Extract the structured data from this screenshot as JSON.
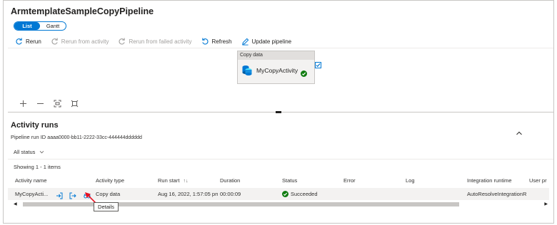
{
  "pipeline_title": "ArmtemplateSampleCopyPipeline",
  "view_toggle": {
    "list": "List",
    "gantt": "Gantt",
    "active": "list"
  },
  "toolbar": {
    "rerun": "Rerun",
    "rerun_from_activity": "Rerun from activity",
    "rerun_from_failed": "Rerun from failed activity",
    "refresh": "Refresh",
    "update_pipeline": "Update pipeline"
  },
  "canvas": {
    "activity_type_header": "Copy data",
    "activity_name": "MyCopyActivity",
    "status_icon": "success-check-icon"
  },
  "canvas_tools": [
    "plus-icon",
    "minus-icon",
    "fit-to-screen-icon",
    "auto-align-icon"
  ],
  "activity_runs": {
    "title": "Activity runs",
    "pipeline_run_label": "Pipeline run ID",
    "pipeline_run_id": "aaaa0000-bb11-2222-33cc-444444dddddd",
    "filter": "All status",
    "showing": "Showing 1 - 1 items",
    "columns": [
      "Activity name",
      "Activity type",
      "Run start",
      "Duration",
      "Status",
      "Error",
      "Log",
      "Integration runtime",
      "User pr"
    ],
    "rows": [
      {
        "activity_name": "MyCopyActi...",
        "activity_type": "Copy data",
        "run_start": "Aug 16, 2022, 1:57:05 pm",
        "duration": "00:00:09",
        "status": "Succeeded",
        "error": "",
        "log": "",
        "integration_runtime": "AutoResolveIntegrationR"
      }
    ]
  },
  "tooltip": "Details",
  "colors": {
    "accent": "#0078d4",
    "success": "#107c10",
    "annotation": "#e81123"
  }
}
